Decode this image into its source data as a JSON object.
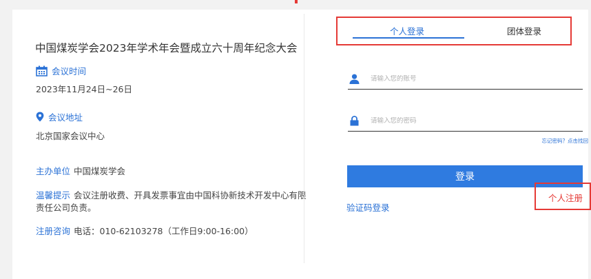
{
  "conference": {
    "title": "中国煤炭学会2023年学术年会暨成立六十周年纪念大会",
    "time_label": "会议时间",
    "time_value": "2023年11月24日~26日",
    "venue_label": "会议地址",
    "venue_value": "北京国家会议中心",
    "host_key": "主办单位",
    "host_value": "中国煤炭学会",
    "notice_key": "温馨提示",
    "notice_value": "会议注册收费、开具发票事宜由中国科协新技术开发中心有限责任公司负责。",
    "consult_key": "注册咨询",
    "consult_value": "电话：010-62103278（工作日9:00-16:00）"
  },
  "login": {
    "tabs": [
      {
        "label": "个人登录",
        "active": true
      },
      {
        "label": "团体登录",
        "active": false
      }
    ],
    "account_placeholder": "请输入您的账号",
    "password_placeholder": "请输入您的密码",
    "forgot_label": "忘记密码？点击找回",
    "submit_label": "登录",
    "code_login_label": "验证码登录",
    "register_label": "个人注册"
  },
  "icons": {
    "time": "calendar-icon",
    "venue": "location-pin-icon",
    "account": "user-icon",
    "password": "lock-icon"
  },
  "colors": {
    "accent": "#2b72d6",
    "button": "#2f7be0",
    "highlight": "#e53935",
    "background": "#f2f2f2"
  }
}
